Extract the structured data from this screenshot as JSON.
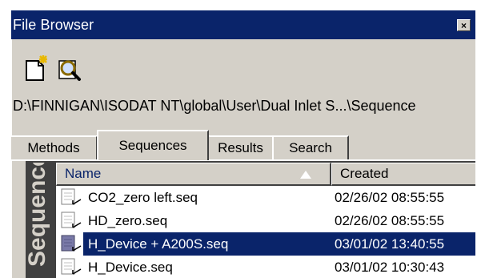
{
  "window": {
    "title": "File Browser",
    "close_glyph": "×",
    "icons": [
      "new-file-icon",
      "search-icon"
    ]
  },
  "path": "D:\\FINNIGAN\\ISODAT NT\\global\\User\\Dual Inlet S...\\Sequence",
  "tabs": [
    {
      "label": "Methods",
      "active": false
    },
    {
      "label": "Sequences",
      "active": true
    },
    {
      "label": "Results",
      "active": false
    },
    {
      "label": "Search",
      "active": false
    }
  ],
  "sidebar": {
    "label": "Sequence"
  },
  "table": {
    "columns": [
      "Name",
      "Created"
    ],
    "sort_column": "Name",
    "rows": [
      {
        "name": "CO2_zero left.seq",
        "created": "02/26/02 08:55:55",
        "selected": false
      },
      {
        "name": "HD_zero.seq",
        "created": "02/26/02 08:55:55",
        "selected": false
      },
      {
        "name": "H_Device + A200S.seq",
        "created": "03/01/02 13:40:55",
        "selected": true
      },
      {
        "name": "H_Device.seq",
        "created": "03/01/02 10:30:43",
        "selected": false
      }
    ]
  },
  "colors": {
    "titlebar": "#0a246a",
    "selection": "#0a246a",
    "face": "#d4d0c8",
    "sidebar": "#404040"
  }
}
